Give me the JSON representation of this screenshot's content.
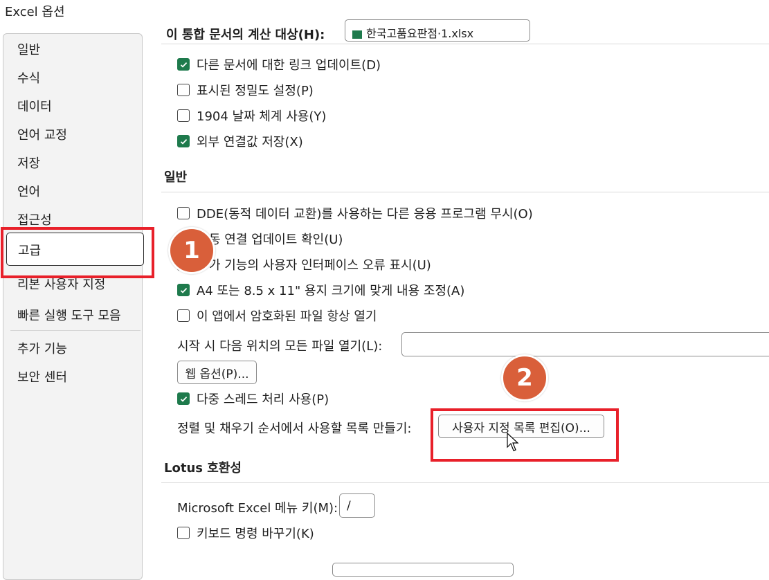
{
  "window": {
    "title": "Excel 옵션"
  },
  "sidebar": {
    "items": [
      {
        "label": "일반"
      },
      {
        "label": "수식"
      },
      {
        "label": "데이터"
      },
      {
        "label": "언어 교정"
      },
      {
        "label": "저장"
      },
      {
        "label": "언어"
      },
      {
        "label": "접근성"
      },
      {
        "label": "고급",
        "selected": true
      },
      {
        "label": "리본 사용자 지정"
      },
      {
        "label": "빠른 실행 도구 모음"
      },
      {
        "label": "추가 기능"
      },
      {
        "label": "보안 센터"
      }
    ]
  },
  "top_partial": {
    "label": "이 통합 문서의 계산 대상(H):",
    "select_value": "한국고품요판점·1.xlsx"
  },
  "calc_options": [
    {
      "label": "다른 문서에 대한 링크 업데이트(D)",
      "checked": true
    },
    {
      "label": "표시된 정밀도 설정(P)",
      "checked": false
    },
    {
      "label": "1904 날짜 체계 사용(Y)",
      "checked": false
    },
    {
      "label": "외부 연결값 저장(X)",
      "checked": true
    }
  ],
  "general": {
    "title": "일반",
    "options": [
      {
        "label": "DDE(동적 데이터 교환)를 사용하는 다른 응용 프로그램 무시(O)",
        "checked": false
      },
      {
        "label": "동 연결 업데이트 확인(U)",
        "checked": true
      },
      {
        "label": "가 기능의 사용자 인터페이스 오류 표시(U)",
        "checked": false
      },
      {
        "label": "A4 또는 8.5 x 11\" 용지 크기에 맞게 내용 조정(A)",
        "checked": true
      },
      {
        "label": "이 앱에서 암호화된 파일 항상 열기",
        "checked": false
      }
    ],
    "startup_label": "시작 시 다음 위치의 모든 파일 열기(L):",
    "startup_value": "",
    "web_options_button": "웹 옵션(P)...",
    "multithread": {
      "label": "다중 스레드 처리 사용(P)",
      "checked": true
    },
    "custom_list_label": "정렬 및 채우기 순서에서 사용할 목록 만들기:",
    "custom_list_button": "사용자 지정 목록 편집(O)..."
  },
  "lotus": {
    "title": "Lotus 호환성",
    "menu_key_label": "Microsoft Excel 메뉴 키(M):",
    "menu_key_value": "/",
    "keyboard_nav": {
      "label": "키보드 명령 바꾸기(K)",
      "checked": false
    }
  },
  "annotations": {
    "badge1": "1",
    "badge2": "2",
    "highlight_color": "#e8202a",
    "badge_color": "#d95f3a"
  },
  "colors": {
    "check_green": "#1e7a4c"
  }
}
